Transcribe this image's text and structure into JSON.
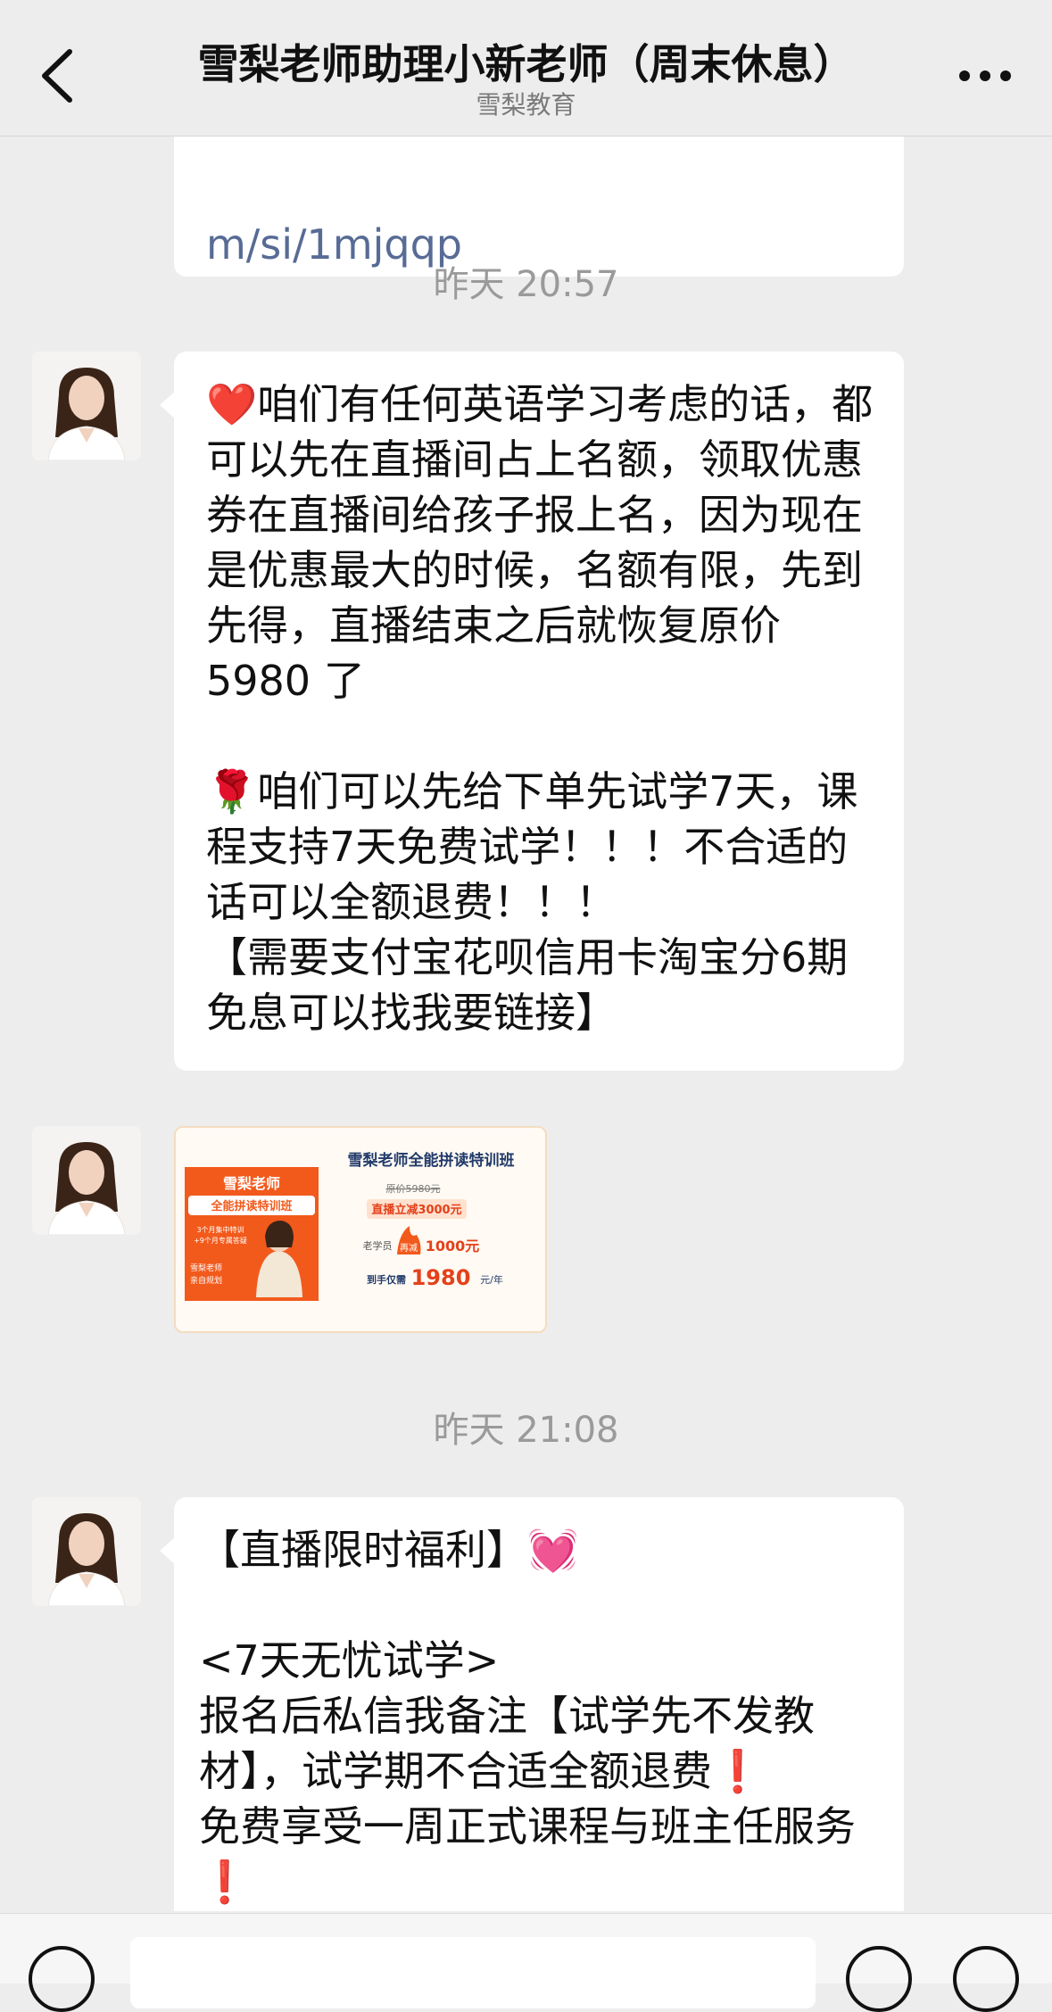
{
  "header": {
    "title": "雪梨老师助理小新老师（周末休息）",
    "subtitle": "雪梨教育"
  },
  "chat": {
    "prev_link_fragment": "m/si/1mjqqp",
    "time1": "昨天 20:57",
    "message1": {
      "para1": "❤️咱们有任何英语学习考虑的话，都可以先在直播间占上名额，领取优惠券在直播间给孩子报上名，因为现在是优惠最大的时候，名额有限，先到先得，直播结束之后就恢复原价 5980 了",
      "para2": "🌹咱们可以先给下单先试学7天，课程支持7天免费试学！！！不合适的话可以全额退费！！！",
      "para3": "【需要支付宝花呗信用卡淘宝分6期免息可以找我要链接】"
    },
    "image_card": {
      "left_title1": "雪梨老师",
      "left_title2": "全能拼读特训班",
      "left_tag1": "3个月集中特训",
      "left_tag2": "+9个月专属答疑",
      "left_foot1": "雪梨老师",
      "left_foot2": "亲自规划",
      "right_title": "雪梨老师全能拼读特训班",
      "orig_price": "原价5980元",
      "live_discount": "直播立减3000元",
      "old_student": "老学员",
      "extra_badge": "再减",
      "extra_amount": "1000元",
      "final_label": "到手仅需",
      "final_price": "1980",
      "final_unit": "元/年"
    },
    "time2": "昨天 21:08",
    "message2": {
      "line1": "【直播限时福利】💓",
      "line2": "<7天无忧试学>",
      "line3": "报名后私信我备注【试学先不发教材】，试学期不合适全额退费❗",
      "line4": "免费享受一周正式课程与班主任服务❗"
    }
  },
  "colors": {
    "background": "#ededed",
    "bubble": "#ffffff",
    "link": "#576b95",
    "timestamp": "#9a9a9a",
    "promo_orange": "#f25a1c"
  }
}
